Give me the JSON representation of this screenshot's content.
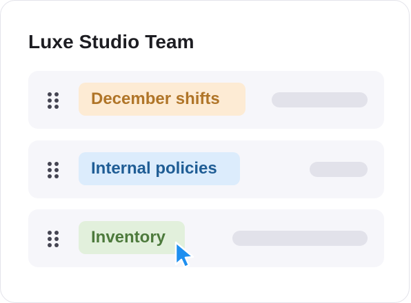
{
  "card": {
    "title": "Luxe Studio Team"
  },
  "rows": [
    {
      "label": "December shifts",
      "tag_color": "#fdebd4",
      "text_color": "#b07528",
      "handle_icon": "drag-handle-icon"
    },
    {
      "label": "Internal policies",
      "tag_color": "#dcecfc",
      "text_color": "#1f5d95",
      "handle_icon": "drag-handle-icon"
    },
    {
      "label": "Inventory",
      "tag_color": "#e2f0dc",
      "text_color": "#4d7a3c",
      "handle_icon": "drag-handle-icon"
    }
  ],
  "cursor": {
    "icon": "mouse-pointer-icon",
    "color": "#1e8ff0"
  }
}
